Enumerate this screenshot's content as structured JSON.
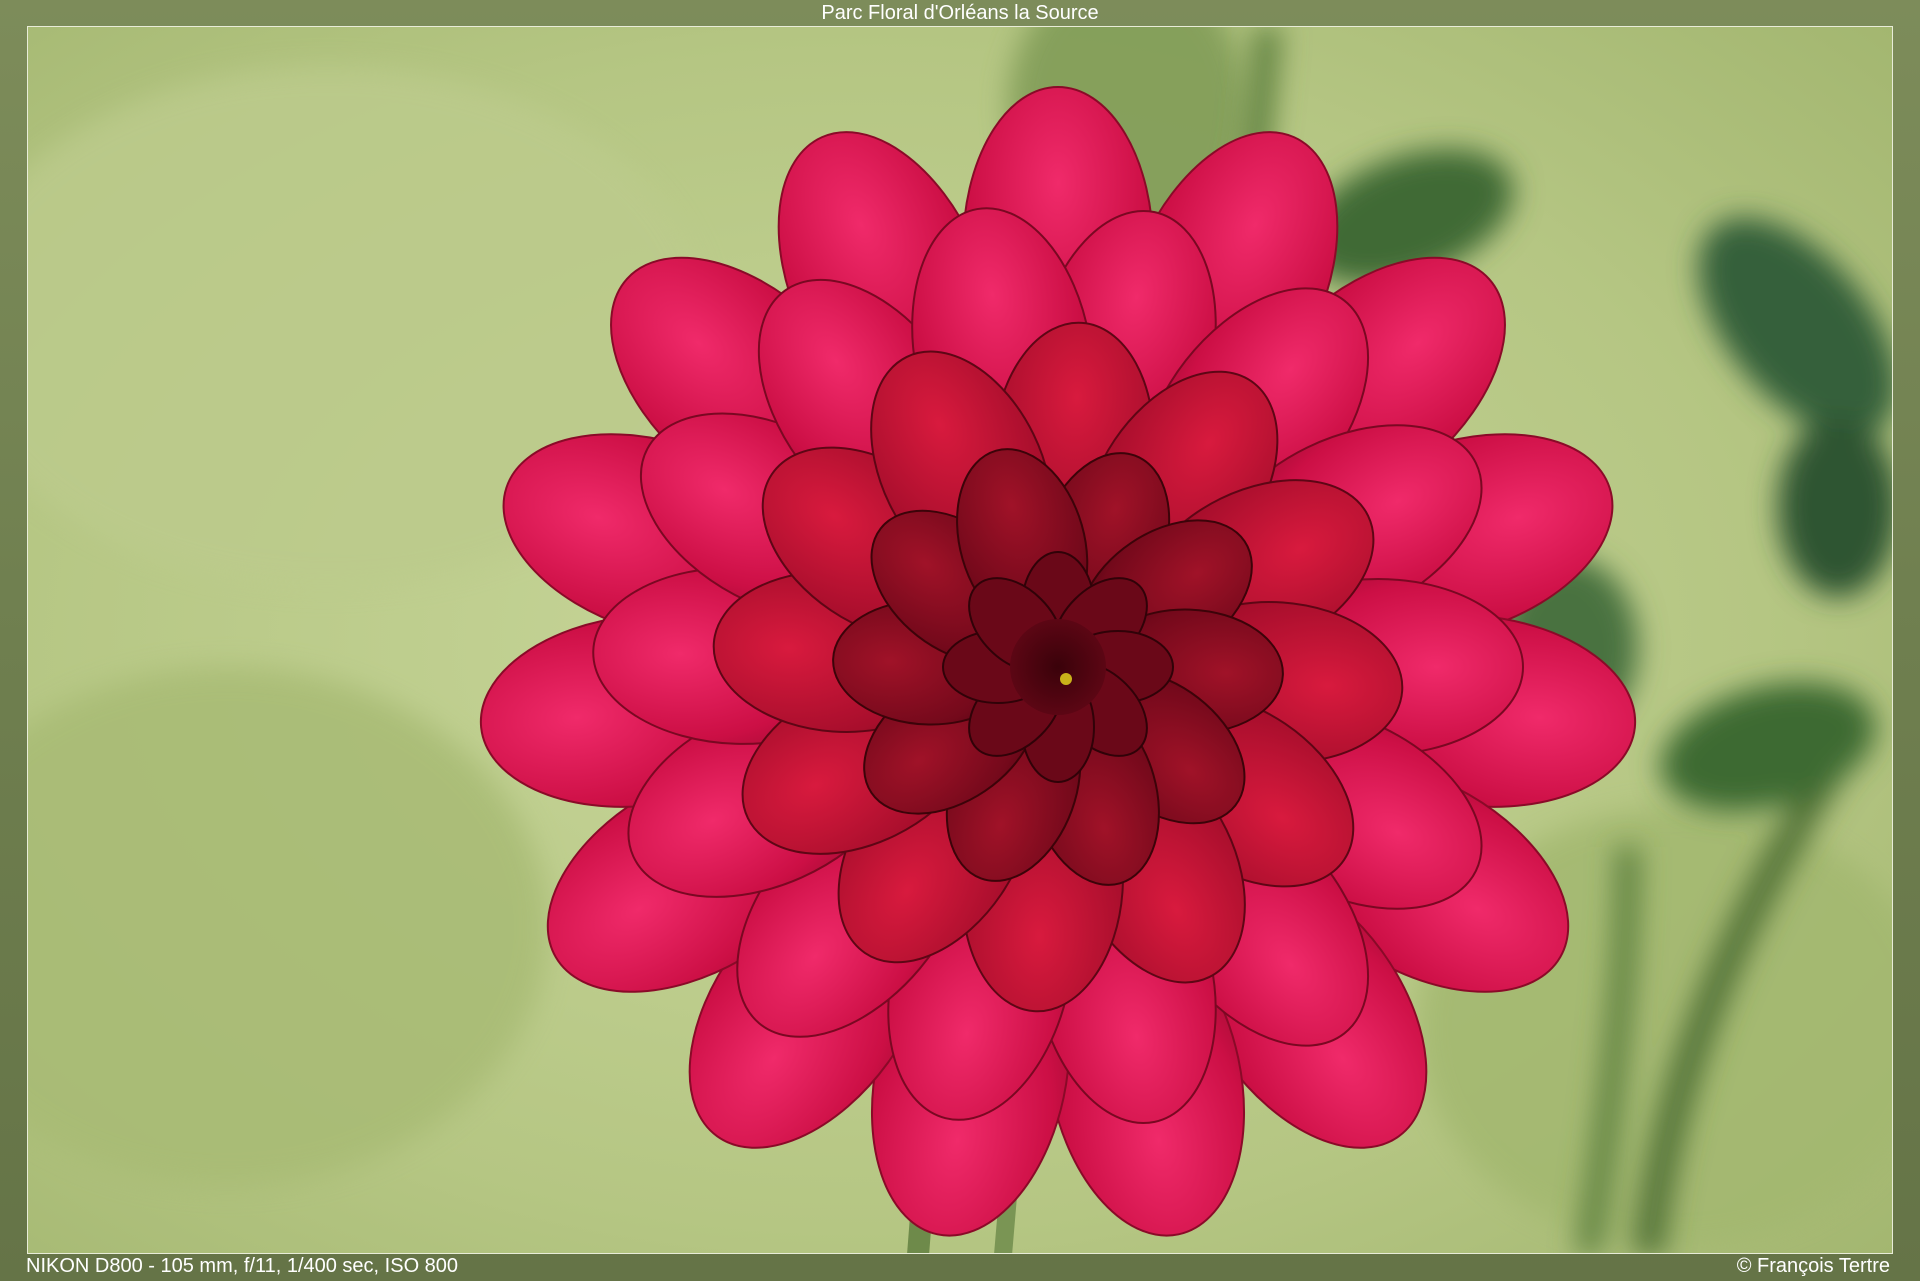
{
  "title": "Parc Floral d'Orléans la Source",
  "exif": "NIKON D800 - 105 mm, f/11, 1/400 sec, ISO 800",
  "copyright": "© François Tertre",
  "photo": {
    "subject": "dahlia-flower",
    "colors": {
      "frame": "#6f7f4f",
      "background": "#b8c98a",
      "petal_outer": "#d4104a",
      "petal_mid": "#b3102f",
      "petal_inner": "#7a0a1e",
      "leaf": "#3e6a33"
    }
  }
}
